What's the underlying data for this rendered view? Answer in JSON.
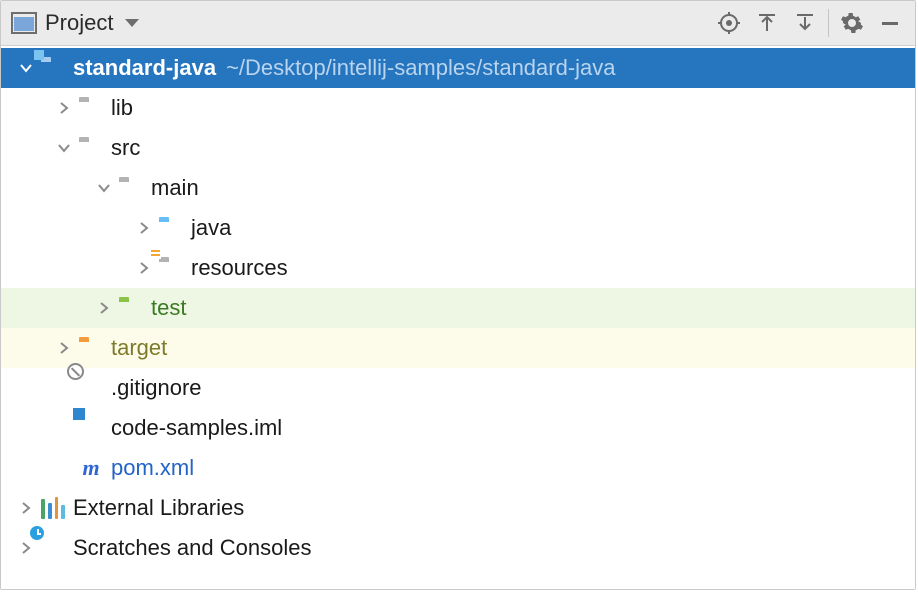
{
  "toolbar": {
    "title": "Project"
  },
  "tree": {
    "root": {
      "name": "standard-java",
      "hint": "~/Desktop/intellij-samples/standard-java"
    },
    "lib": "lib",
    "src": "src",
    "main": "main",
    "java": "java",
    "resources": "resources",
    "test": "test",
    "target": "target",
    "gitignore": ".gitignore",
    "iml": "code-samples.iml",
    "pom": "pom.xml",
    "external": "External Libraries",
    "scratches": "Scratches and Consoles"
  }
}
